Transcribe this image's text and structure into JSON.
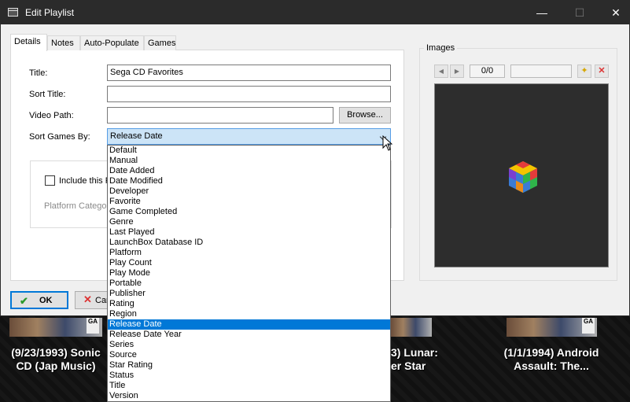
{
  "window": {
    "title": "Edit Playlist",
    "min_label": "—",
    "max_label": "☐",
    "close_label": "✕"
  },
  "tabs": [
    {
      "label": "Details",
      "active": true
    },
    {
      "label": "Notes",
      "active": false
    },
    {
      "label": "Auto-Populate",
      "active": false
    },
    {
      "label": "Games",
      "active": false
    }
  ],
  "details": {
    "title_label": "Title:",
    "title_value": "Sega CD Favorites",
    "sort_title_label": "Sort Title:",
    "sort_title_value": "",
    "video_path_label": "Video Path:",
    "video_path_value": "",
    "browse_label": "Browse...",
    "sort_games_label": "Sort Games By:",
    "sort_games_value": "Release Date",
    "include_label": "Include this P",
    "platform_category_label": "Platform Catego"
  },
  "sort_options": [
    "Default",
    "Manual",
    "Date Added",
    "Date Modified",
    "Developer",
    "Favorite",
    "Game Completed",
    "Genre",
    "Last Played",
    "LaunchBox Database ID",
    "Platform",
    "Play Count",
    "Play Mode",
    "Portable",
    "Publisher",
    "Rating",
    "Region",
    "Release Date",
    "Release Date Year",
    "Series",
    "Source",
    "Star Rating",
    "Status",
    "Title",
    "Version"
  ],
  "sort_selected": "Release Date",
  "buttons": {
    "ok_label": "OK",
    "cancel_label": "Car"
  },
  "images": {
    "group_label": "Images",
    "counter": "0/0",
    "prev_icon": "◀",
    "next_icon": "▶",
    "add_icon": "✦",
    "delete_icon": "✕"
  },
  "background_games": [
    {
      "line1": "(9/23/1993) Sonic",
      "line2": "CD (Jap Music)"
    },
    {
      "line1": "3) Lunar:",
      "line2": "er Star"
    },
    {
      "line1": "(1/1/1994) Android",
      "line2": "Assault: The..."
    }
  ],
  "colors": {
    "titlebar": "#2b2b2b",
    "selection": "#0078d7",
    "combo_focus": "#cce4f7"
  }
}
